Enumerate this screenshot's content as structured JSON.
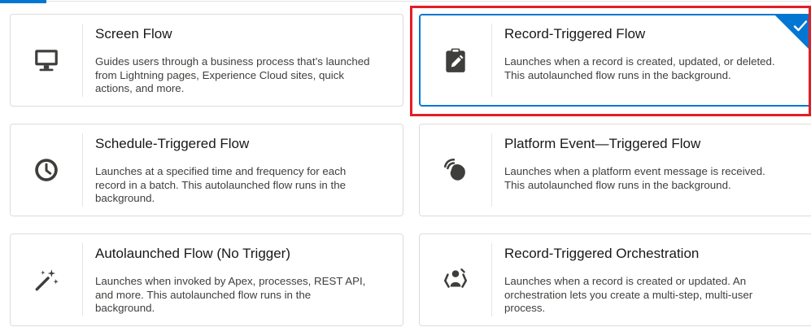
{
  "colors": {
    "accent": "#0176d3",
    "highlight": "#e41e26",
    "border": "#dddbda",
    "icon": "#3e3e3c"
  },
  "cards": [
    {
      "icon": "monitor-icon",
      "title": "Screen Flow",
      "description": "Guides users through a business process that’s launched from Lightning pages, Experience Cloud sites, quick actions, and more.",
      "selected": false
    },
    {
      "icon": "clipboard-pencil-icon",
      "title": "Record-Triggered Flow",
      "description": "Launches when a record is created, updated, or deleted. This autolaunched flow runs in the background.",
      "selected": true
    },
    {
      "icon": "clock-icon",
      "title": "Schedule-Triggered Flow",
      "description": "Launches at a specified time and frequency for each record in a batch. This autolaunched flow runs in the background.",
      "selected": false
    },
    {
      "icon": "platform-event-icon",
      "title": "Platform Event—Triggered Flow",
      "description": "Launches when a platform event message is received. This autolaunched flow runs in the background.",
      "selected": false
    },
    {
      "icon": "magic-wand-icon",
      "title": "Autolaunched Flow (No Trigger)",
      "description": "Launches when invoked by Apex, processes, REST API, and more. This autolaunched flow runs in the background.",
      "selected": false
    },
    {
      "icon": "orchestration-icon",
      "title": "Record-Triggered Orchestration",
      "description": "Launches when a record is created or updated. An orchestration lets you create a multi-step, multi-user process.",
      "selected": false
    }
  ]
}
